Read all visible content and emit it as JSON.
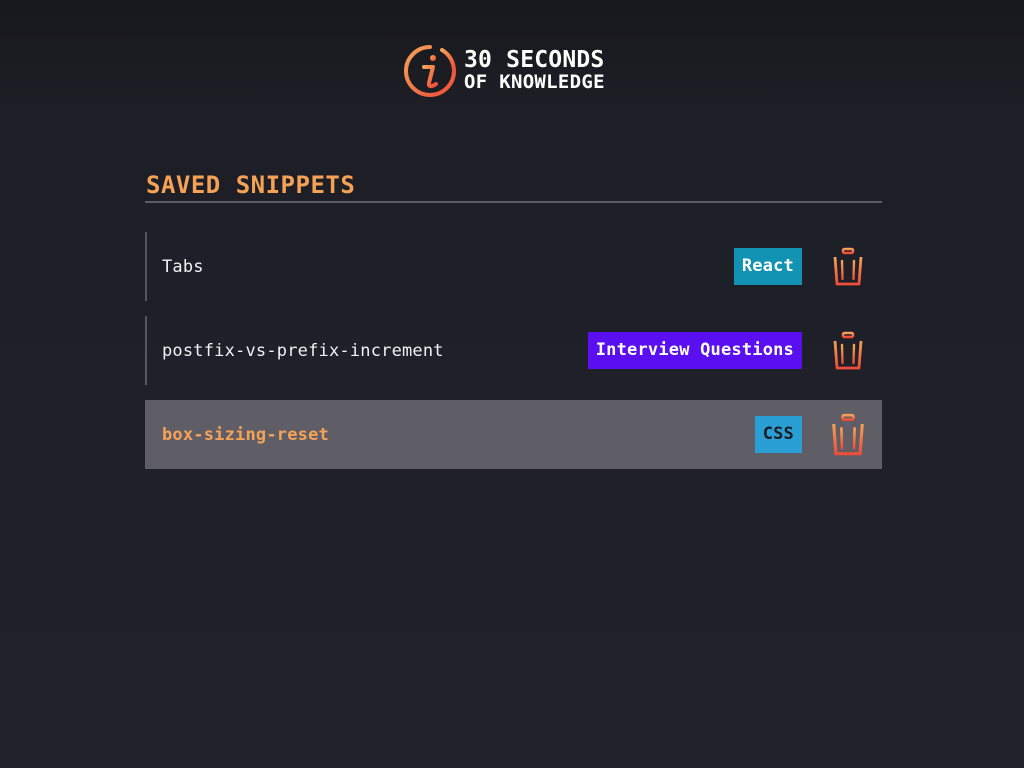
{
  "brand": {
    "line1": "30 SECONDS",
    "line2": "OF KNOWLEDGE",
    "logo_icon": "info-pin-icon",
    "accent_colors": [
      "#f06a3a",
      "#f5a257"
    ]
  },
  "page": {
    "title": "SAVED SNIPPETS"
  },
  "snippets": [
    {
      "name": "Tabs",
      "tag": "React",
      "tag_color": "#1393b3",
      "delete_icon": "trash-icon",
      "active": false
    },
    {
      "name": "postfix-vs-prefix-increment",
      "tag": "Interview Questions",
      "tag_color": "#5a0ff0",
      "delete_icon": "trash-icon",
      "active": false
    },
    {
      "name": "box-sizing-reset",
      "tag": "CSS",
      "tag_color": "#2a9fd6",
      "delete_icon": "trash-icon",
      "active": true
    }
  ]
}
